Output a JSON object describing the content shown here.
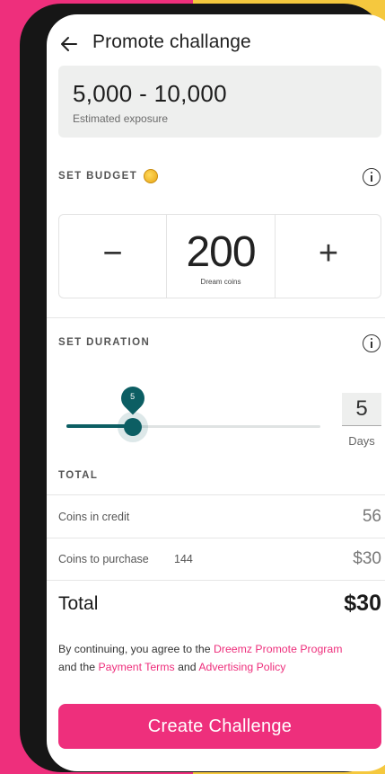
{
  "header": {
    "title": "Promote challange"
  },
  "exposure": {
    "range": "5,000 - 10,000",
    "label": "Estimated exposure"
  },
  "budget": {
    "section_label": "SET BUDGET",
    "minus": "−",
    "value": "200",
    "unit": "Dream coins",
    "plus": "+"
  },
  "duration": {
    "section_label": "SET DURATION",
    "slider_value": 5,
    "slider_fraction": 0.26,
    "bubble": "5",
    "days_value": "5",
    "days_label": "Days"
  },
  "totals": {
    "section_label": "TOTAL",
    "credit_label": "Coins in credit",
    "credit_value": "56",
    "purchase_label": "Coins to purchase",
    "purchase_count": "144",
    "purchase_value": "$30",
    "total_label": "Total",
    "total_value": "$30"
  },
  "terms": {
    "prefix": "By continuing, you agree to the ",
    "link1": "Dreemz Promote Program",
    "mid": " and the ",
    "link2": "Payment Terms",
    "and": " and ",
    "link3": "Advertising Policy"
  },
  "cta": {
    "label": "Create Challenge"
  },
  "colors": {
    "accent": "#ee2f7c",
    "slider": "#0c5e63",
    "background_left": "#ee2f7c",
    "background_right": "#f5c83e"
  },
  "icons": [
    "back-arrow-icon",
    "coin-icon",
    "info-icon"
  ]
}
